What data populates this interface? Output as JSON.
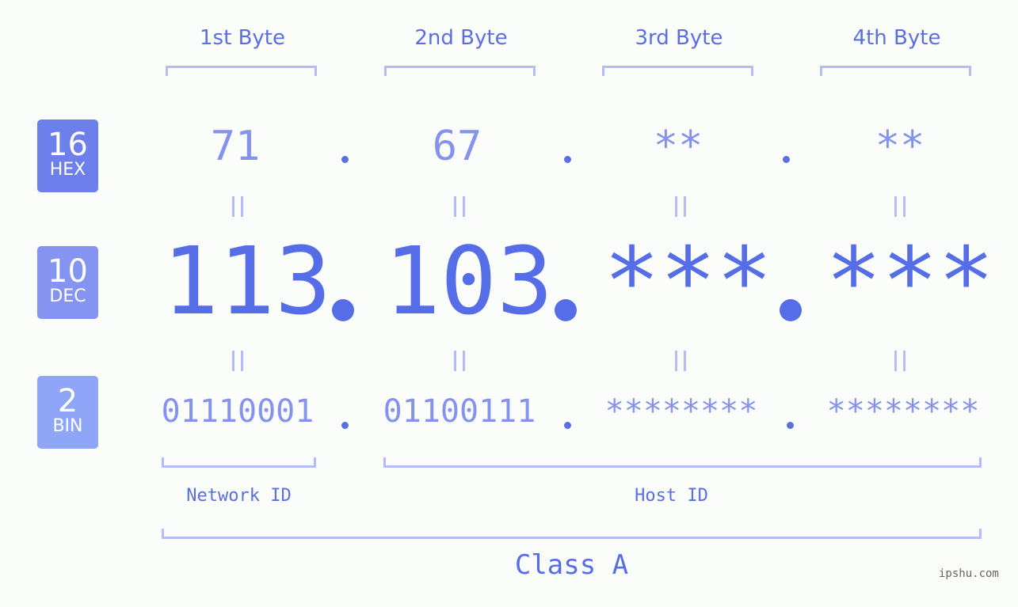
{
  "byte_headers": [
    "1st Byte",
    "2nd Byte",
    "3rd Byte",
    "4th Byte"
  ],
  "bases": [
    {
      "number": "16",
      "label": "HEX",
      "color": "#6d7fea"
    },
    {
      "number": "10",
      "label": "DEC",
      "color": "#8594f0"
    },
    {
      "number": "2",
      "label": "BIN",
      "color": "#8fa6f8"
    }
  ],
  "hex": [
    "71",
    "67",
    "**",
    "**"
  ],
  "dec": [
    "113",
    "103",
    "***",
    "***"
  ],
  "bin": [
    "01110001",
    "01100111",
    "********",
    "********"
  ],
  "separator": ".",
  "network_id_label": "Network ID",
  "host_id_label": "Host ID",
  "class_label": "Class A",
  "watermark": "ipshu.com",
  "colors": {
    "primary": "#566de8",
    "light": "#8592ee",
    "bracket": "#b5bdf7"
  }
}
